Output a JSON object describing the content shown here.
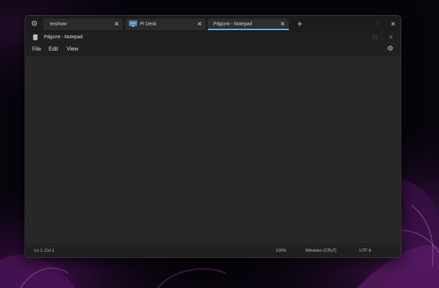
{
  "tabs": [
    {
      "label": "tmshow",
      "close_glyph": "✕"
    },
    {
      "label": "Pi Desk",
      "close_glyph": "✕"
    },
    {
      "label": "Pdgcmt - Notepad",
      "close_glyph": "✕",
      "active": true
    }
  ],
  "tabstrip": {
    "new_tab_glyph": "+",
    "app_icon": "gear-icon"
  },
  "window_controls": {
    "minimize_glyph": "⫶",
    "close_glyph": "✕"
  },
  "notepad": {
    "title": "Pdgcmt - Notepad",
    "maximize_glyph": "□",
    "close_glyph": "✕",
    "menu": [
      "File",
      "Edit",
      "View"
    ],
    "settings_icon": "gear-icon",
    "content": ""
  },
  "status_bar": {
    "position": "Ln 1, Col 1",
    "zoom": "100%",
    "line_ending": "Windows (CRLF)",
    "encoding": "UTF-8"
  },
  "colors": {
    "accent": "#4cc2ff",
    "editor_background": "#272727",
    "chrome_background": "#1c1c1c",
    "wallpaper_accent": "#6a1f7a"
  }
}
